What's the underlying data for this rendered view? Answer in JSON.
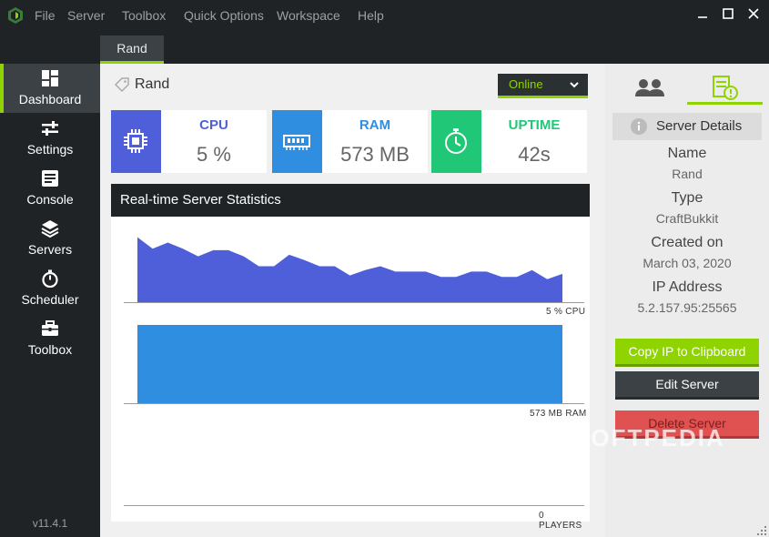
{
  "menu": [
    "File",
    "Server",
    "Toolbox",
    "Quick Options",
    "Workspace",
    "Help"
  ],
  "tab": "Rand",
  "sidebar": {
    "items": [
      {
        "label": "Dashboard"
      },
      {
        "label": "Settings"
      },
      {
        "label": "Console"
      },
      {
        "label": "Servers"
      },
      {
        "label": "Scheduler"
      },
      {
        "label": "Toolbox"
      }
    ],
    "version": "v11.4.1"
  },
  "server": {
    "name": "Rand",
    "status": "Online"
  },
  "cards": [
    {
      "title": "CPU",
      "value": "5 %",
      "color": "#4f5fd9"
    },
    {
      "title": "RAM",
      "value": "573 MB",
      "color": "#2f8ee0"
    },
    {
      "title": "UPTIME",
      "value": "42s",
      "color": "#1fc777"
    }
  ],
  "stats": {
    "title": "Real-time Server Statistics",
    "cpu_label": "5 % CPU",
    "ram_label": "573 MB RAM",
    "players_label": "0 PLAYERS",
    "cpu_series": [
      85,
      70,
      78,
      70,
      60,
      68,
      68,
      60,
      47,
      47,
      62,
      55,
      47,
      47,
      35,
      42,
      47,
      40,
      40,
      40,
      33,
      33,
      40,
      40,
      33,
      33,
      42,
      30,
      37
    ],
    "ram_fill": 1.0
  },
  "details": {
    "header": "Server Details",
    "name_label": "Name",
    "name_value": "Rand",
    "type_label": "Type",
    "type_value": "CraftBukkit",
    "created_label": "Created on",
    "created_value": "March 03, 2020",
    "ip_label": "IP Address",
    "ip_value": "5.2.157.95:25565"
  },
  "buttons": {
    "copy": "Copy IP to Clipboard",
    "edit": "Edit Server",
    "delete": "Delete Server"
  },
  "watermark": "SOFTPEDIA",
  "colors": {
    "accent": "#8fd400",
    "dark": "#1f2326",
    "cpu": "#4f5fd9",
    "ram": "#2f8ee0",
    "uptime": "#1fc777",
    "danger": "#e05252"
  }
}
